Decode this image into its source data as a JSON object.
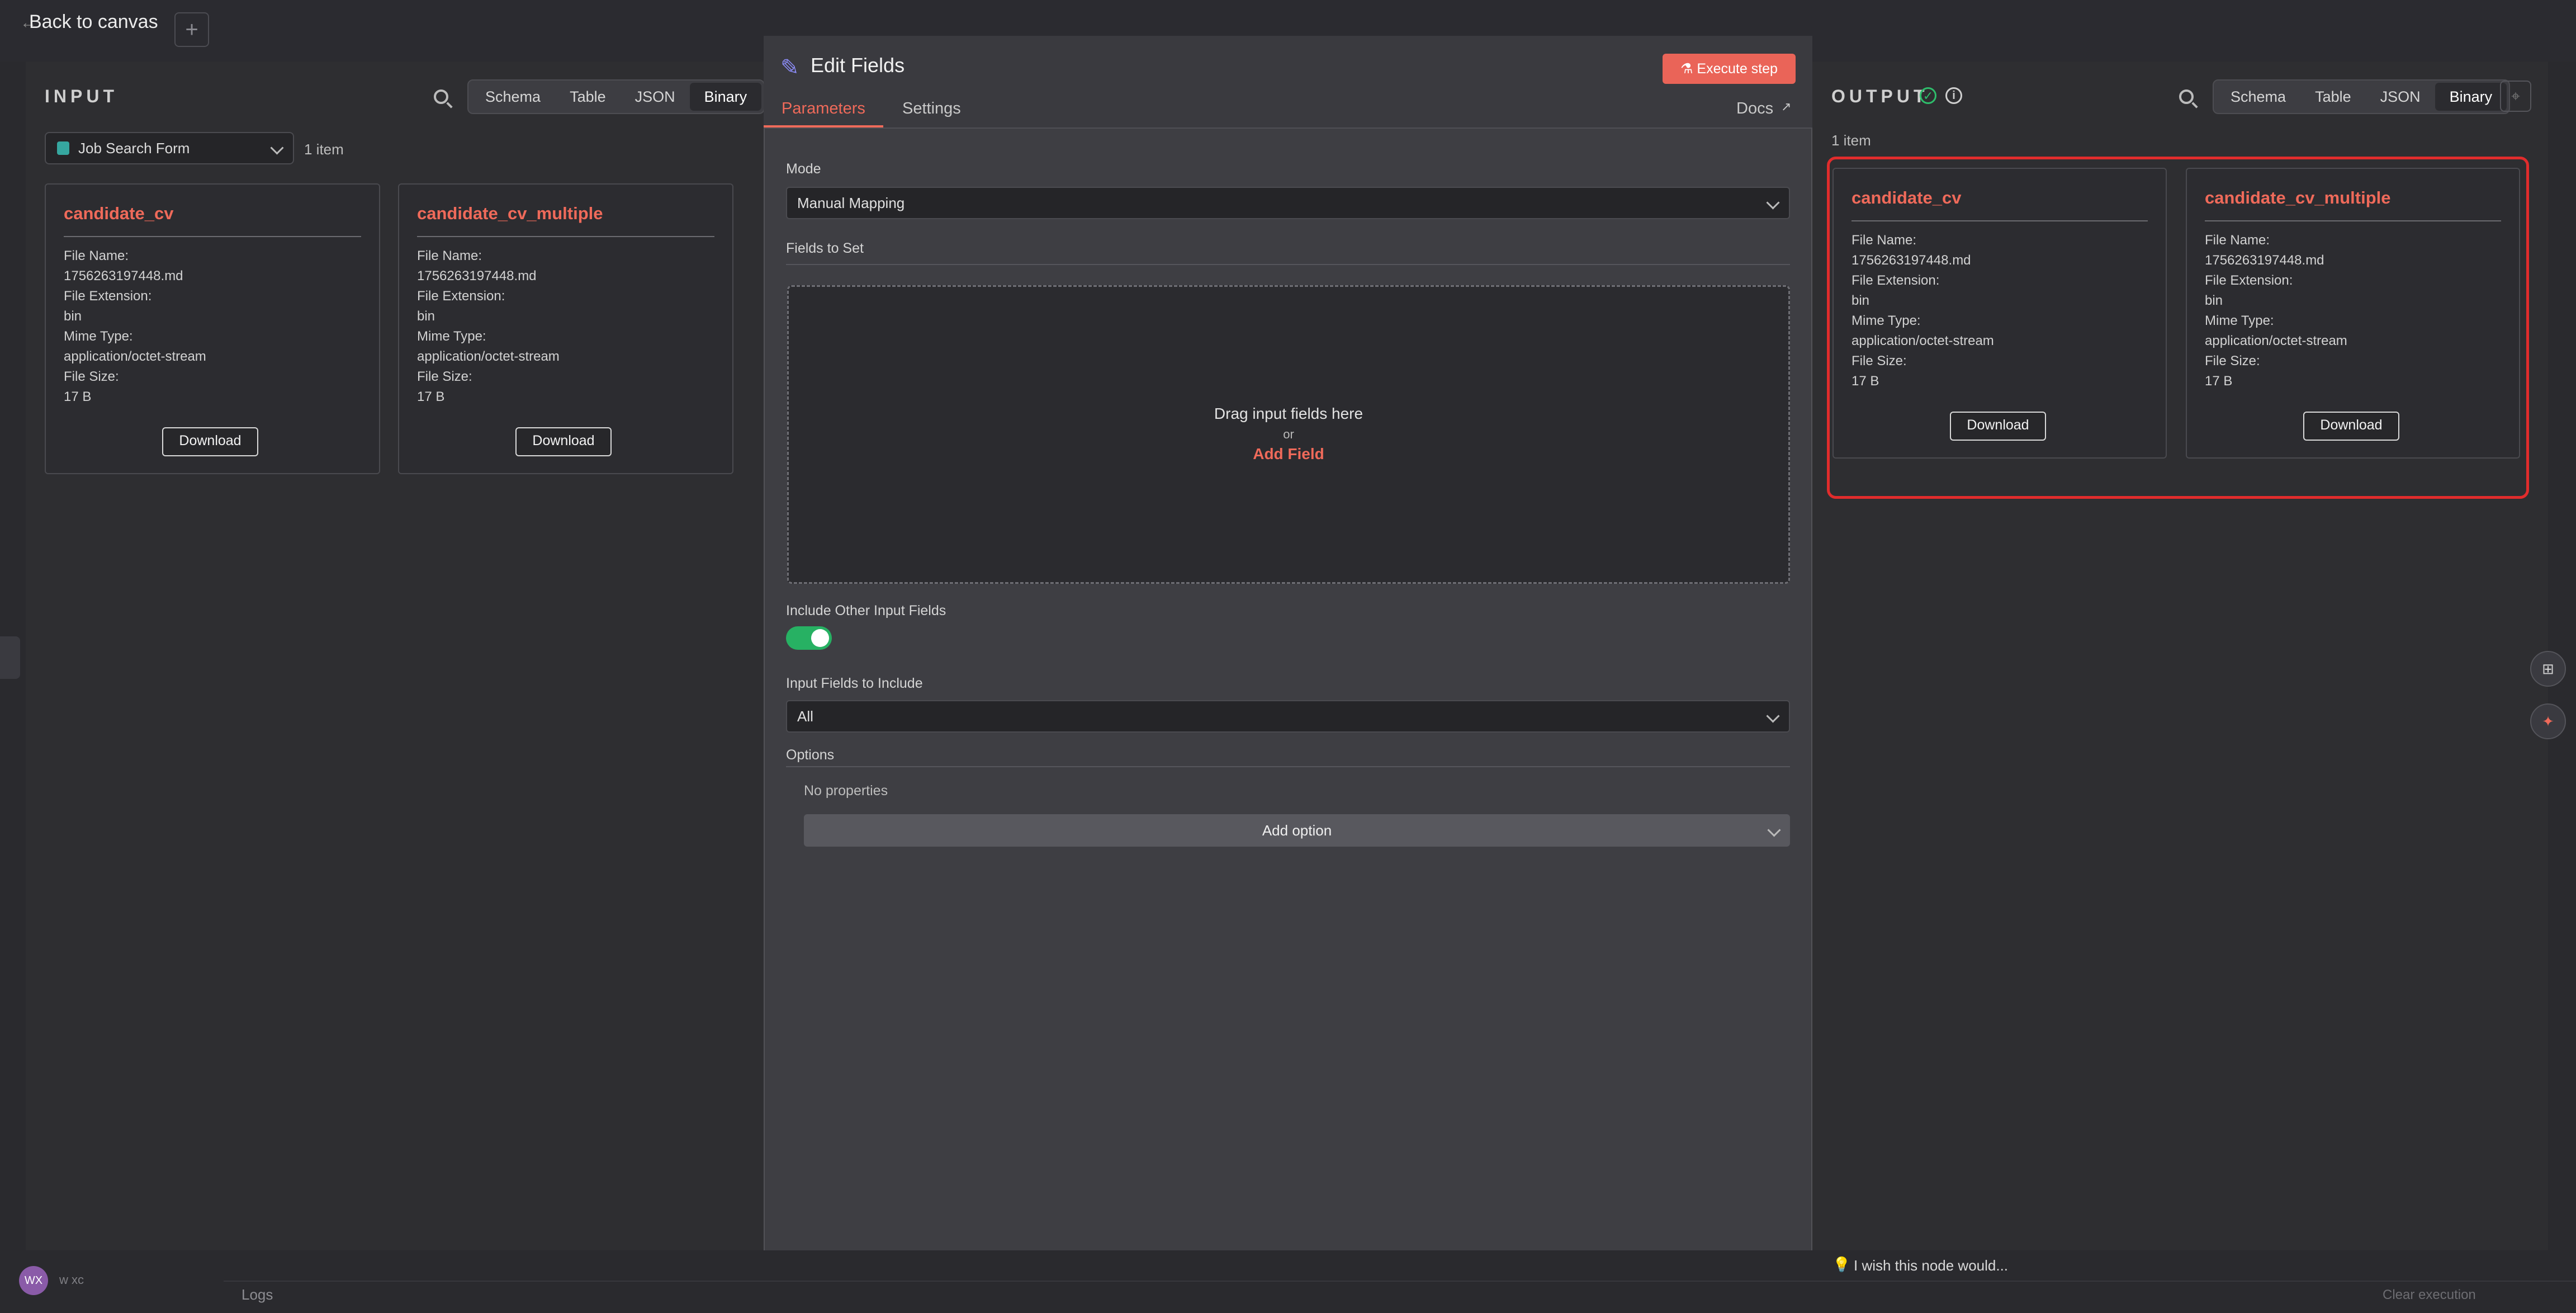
{
  "topbar": {
    "back_label": "Back to canvas",
    "plus": "+"
  },
  "input": {
    "title": "INPUT",
    "views": [
      "Schema",
      "Table",
      "JSON",
      "Binary"
    ],
    "active_view": "Binary",
    "node_select": "Job Search Form",
    "items_count": "1 item",
    "cards": [
      {
        "title": "candidate_cv",
        "file_name_label": "File Name:",
        "file_name": "1756263197448.md",
        "ext_label": "File Extension:",
        "ext": "bin",
        "mime_label": "Mime Type:",
        "mime": "application/octet-stream",
        "size_label": "File Size:",
        "size": "17 B",
        "download": "Download"
      },
      {
        "title": "candidate_cv_multiple",
        "file_name_label": "File Name:",
        "file_name": "1756263197448.md",
        "ext_label": "File Extension:",
        "ext": "bin",
        "mime_label": "Mime Type:",
        "mime": "application/octet-stream",
        "size_label": "File Size:",
        "size": "17 B",
        "download": "Download"
      }
    ]
  },
  "edit": {
    "title": "Edit Fields",
    "execute_label": "Execute step",
    "tabs": [
      "Parameters",
      "Settings"
    ],
    "docs_label": "Docs",
    "mode_label": "Mode",
    "mode_value": "Manual Mapping",
    "fields_to_set_label": "Fields to Set",
    "drop_text": "Drag input fields here",
    "drop_or": "or",
    "add_field": "Add Field",
    "include_other_label": "Include Other Input Fields",
    "include_other_on": true,
    "input_fields_label": "Input Fields to Include",
    "input_fields_value": "All",
    "options_label": "Options",
    "no_properties": "No properties",
    "add_option": "Add option"
  },
  "output": {
    "title": "OUTPUT",
    "views": [
      "Schema",
      "Table",
      "JSON",
      "Binary"
    ],
    "active_view": "Binary",
    "items_count": "1 item",
    "cards": [
      {
        "title": "candidate_cv",
        "file_name_label": "File Name:",
        "file_name": "1756263197448.md",
        "ext_label": "File Extension:",
        "ext": "bin",
        "mime_label": "Mime Type:",
        "mime": "application/octet-stream",
        "size_label": "File Size:",
        "size": "17 B",
        "download": "Download"
      },
      {
        "title": "candidate_cv_multiple",
        "file_name_label": "File Name:",
        "file_name": "1756263197448.md",
        "ext_label": "File Extension:",
        "ext": "bin",
        "mime_label": "Mime Type:",
        "mime": "application/octet-stream",
        "size_label": "File Size:",
        "size": "17 B",
        "download": "Download"
      }
    ],
    "highlight_color": "#e12c2c"
  },
  "bottom": {
    "wish_label": "I wish this node would...",
    "logs_label": "Logs",
    "clear_execution": "Clear execution",
    "user_initials": "WX",
    "user_name": "w xc"
  },
  "colors": {
    "accent": "#ef6a5a",
    "success": "#27b163",
    "pencil": "#8b8bf5"
  }
}
